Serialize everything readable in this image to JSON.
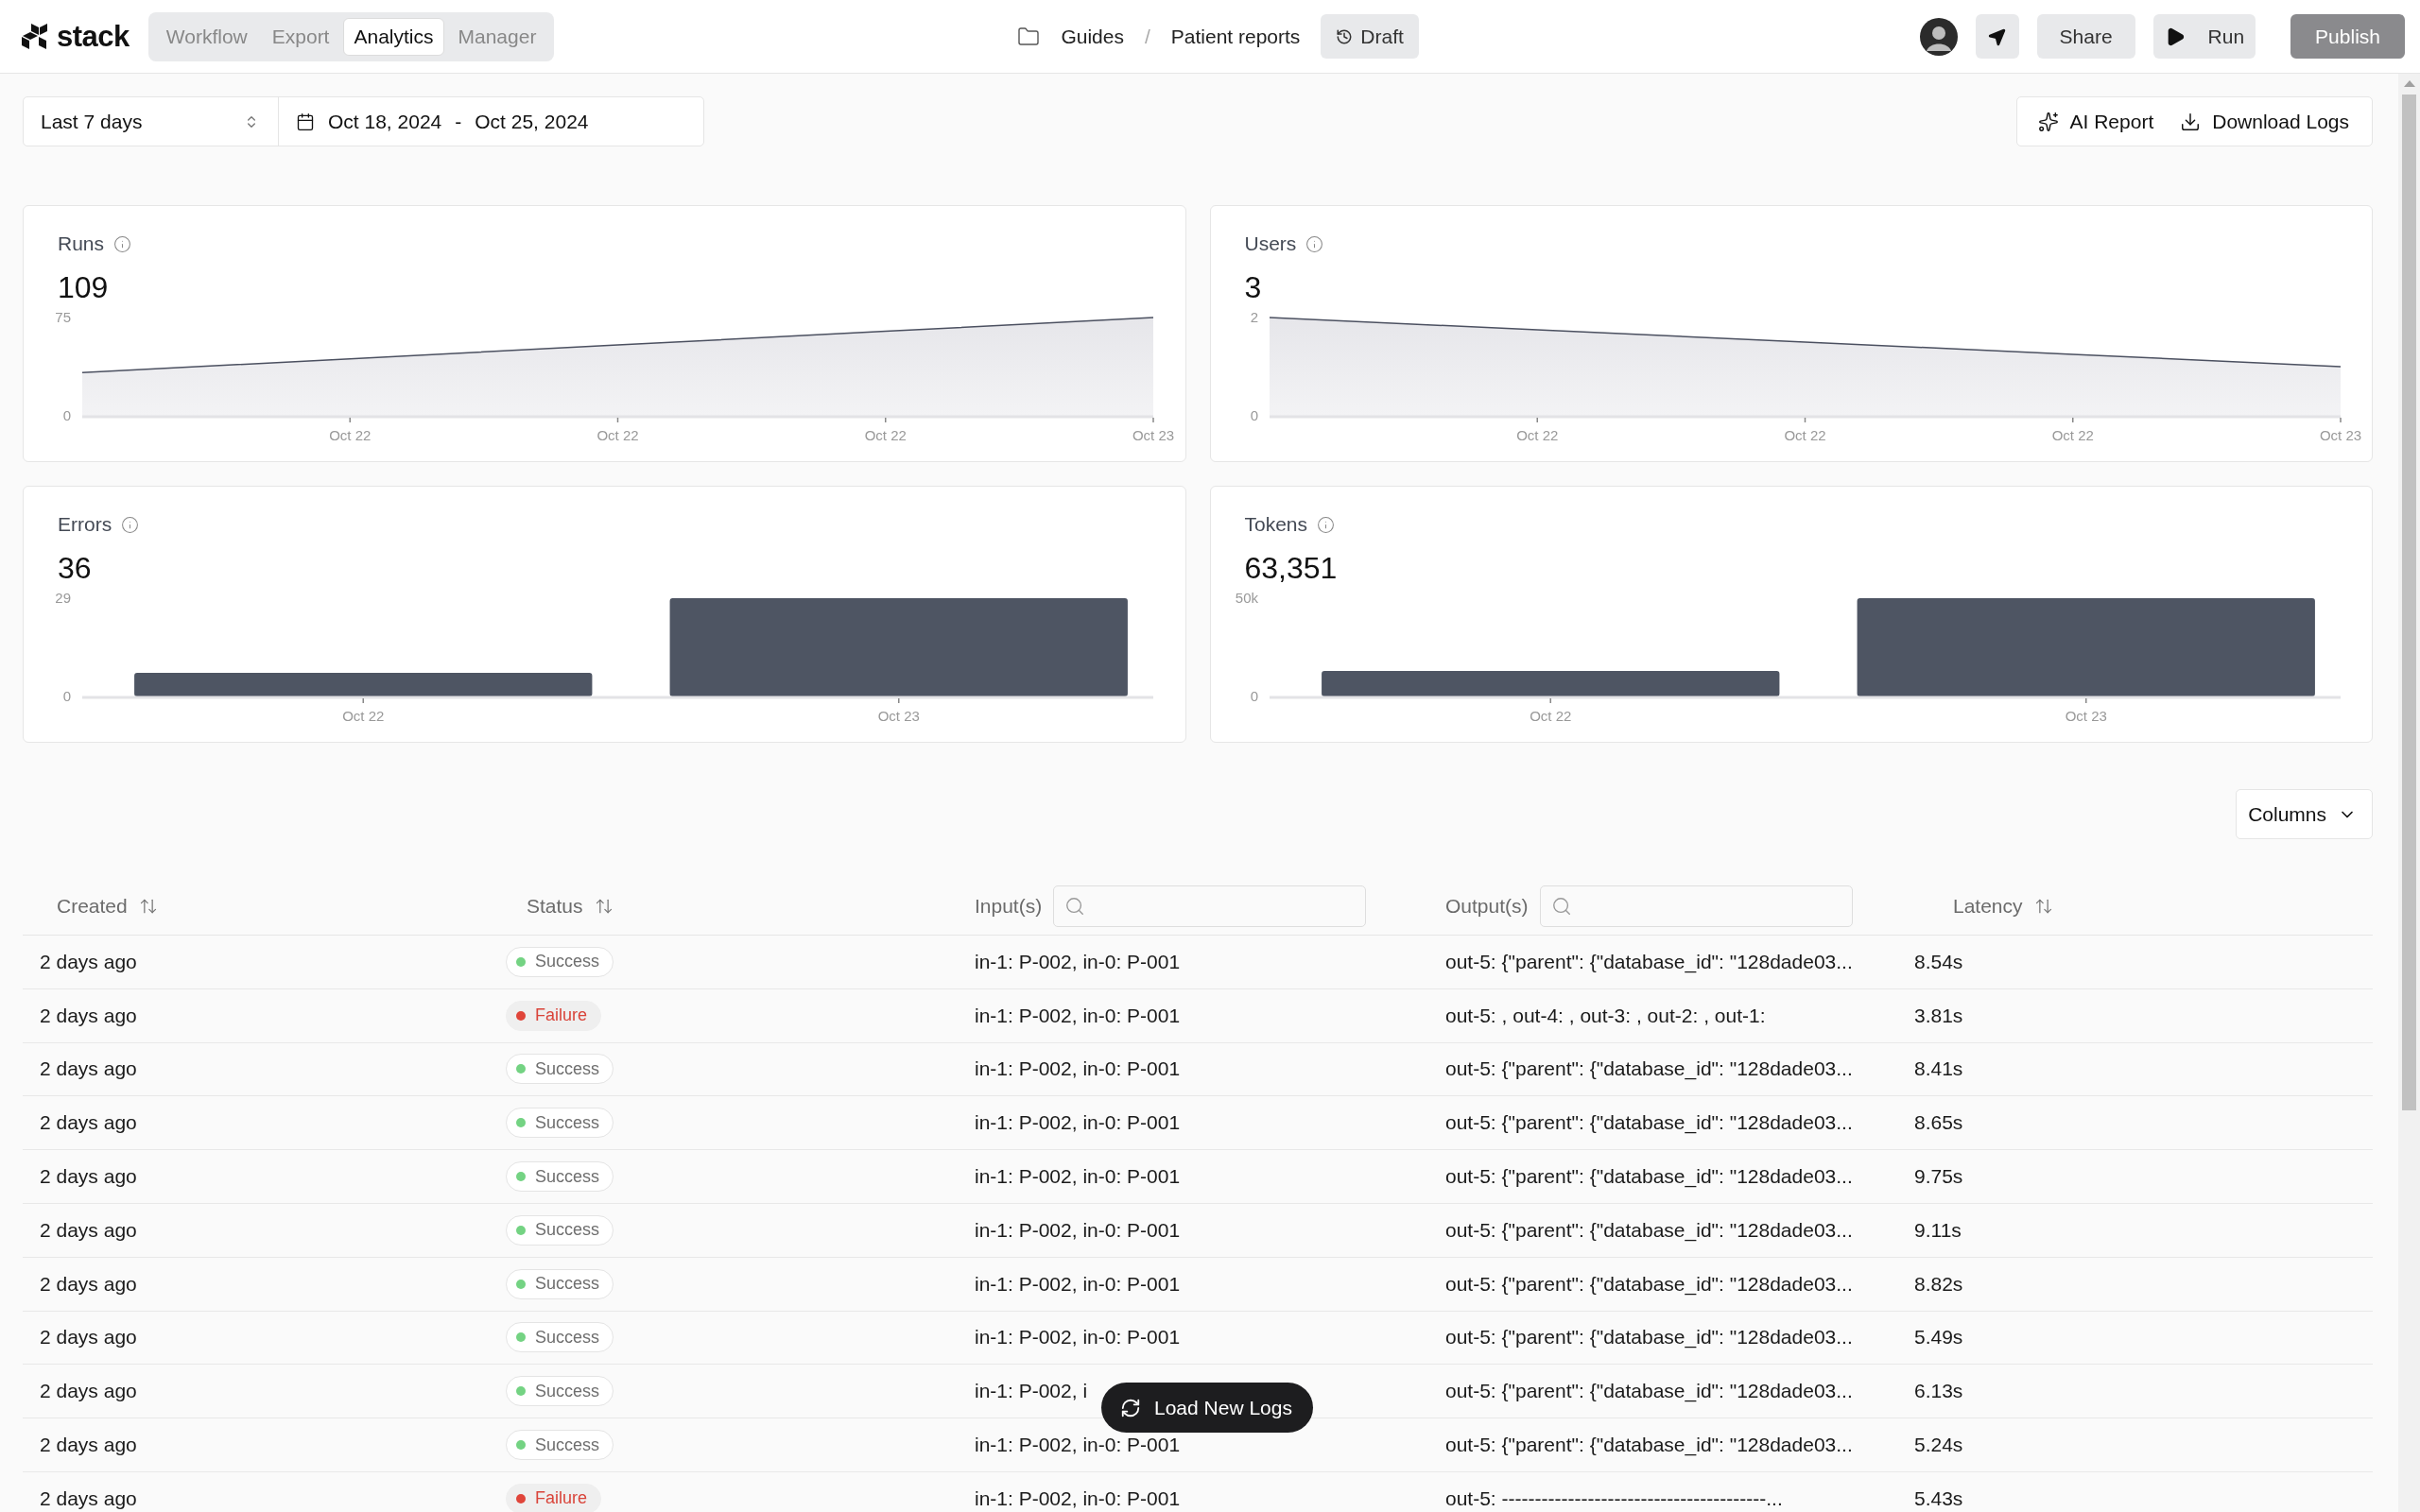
{
  "app": {
    "logo": "stack",
    "tabs": [
      {
        "label": "Workflow",
        "selected": false
      },
      {
        "label": "Export",
        "selected": false
      },
      {
        "label": "Analytics",
        "selected": true
      },
      {
        "label": "Manager",
        "selected": false
      }
    ]
  },
  "breadcrumb": {
    "items": [
      "Guides",
      "Patient reports"
    ],
    "separator": "/",
    "status_button": "Draft"
  },
  "actions": {
    "share": "Share",
    "run": "Run",
    "publish": "Publish"
  },
  "filters": {
    "range_select": "Last 7 days",
    "date_start": "Oct 18, 2024",
    "date_separator": "-",
    "date_end": "Oct 25, 2024",
    "ai_report": "AI Report",
    "download_logs": "Download Logs"
  },
  "metrics": [
    {
      "title": "Runs",
      "value": "109",
      "chart_data": {
        "type": "area",
        "categories": [
          null,
          "Oct 22",
          "Oct 22",
          "Oct 22",
          "Oct 23"
        ],
        "values": [
          33,
          43.5,
          54,
          64.5,
          75
        ],
        "ylim": [
          0,
          75
        ],
        "yticks": [
          0,
          75
        ]
      }
    },
    {
      "title": "Users",
      "value": "3",
      "chart_data": {
        "type": "area",
        "categories": [
          null,
          "Oct 22",
          "Oct 22",
          "Oct 22",
          "Oct 23"
        ],
        "values": [
          2,
          1.75,
          1.5,
          1.25,
          1
        ],
        "ylim": [
          0,
          2
        ],
        "yticks": [
          0,
          2
        ]
      }
    },
    {
      "title": "Errors",
      "value": "36",
      "chart_data": {
        "type": "bar",
        "categories": [
          "Oct 22",
          "Oct 23"
        ],
        "values": [
          7,
          29
        ],
        "ylim": [
          0,
          29
        ],
        "yticks": [
          0,
          29
        ]
      }
    },
    {
      "title": "Tokens",
      "value": "63,351",
      "chart_data": {
        "type": "bar",
        "categories": [
          "Oct 22",
          "Oct 23"
        ],
        "values": [
          13000,
          50000
        ],
        "ylim": [
          0,
          50000
        ],
        "yticks": [
          0,
          {
            "value": 50000,
            "label": "50k"
          }
        ]
      }
    }
  ],
  "table": {
    "columns_button": "Columns",
    "columns": [
      {
        "label": "Created",
        "kind": "sortable"
      },
      {
        "label": "Status",
        "kind": "sortable"
      },
      {
        "label": "Input(s)",
        "kind": "searchable"
      },
      {
        "label": "Output(s)",
        "kind": "searchable"
      },
      {
        "label": "Latency",
        "kind": "sortable"
      }
    ],
    "rows": [
      {
        "created": "2 days ago",
        "status": "Success",
        "kind": "success",
        "input": "in-1: P-002, in-0: P-001",
        "output": "out-5: {\"parent\": {\"database_id\": \"128dade03...",
        "latency": "8.54s"
      },
      {
        "created": "2 days ago",
        "status": "Failure",
        "kind": "failure",
        "input": "in-1: P-002, in-0: P-001",
        "output": "out-5: , out-4: , out-3: , out-2: , out-1:",
        "latency": "3.81s"
      },
      {
        "created": "2 days ago",
        "status": "Success",
        "kind": "success",
        "input": "in-1: P-002, in-0: P-001",
        "output": "out-5: {\"parent\": {\"database_id\": \"128dade03...",
        "latency": "8.41s"
      },
      {
        "created": "2 days ago",
        "status": "Success",
        "kind": "success",
        "input": "in-1: P-002, in-0: P-001",
        "output": "out-5: {\"parent\": {\"database_id\": \"128dade03...",
        "latency": "8.65s"
      },
      {
        "created": "2 days ago",
        "status": "Success",
        "kind": "success",
        "input": "in-1: P-002, in-0: P-001",
        "output": "out-5: {\"parent\": {\"database_id\": \"128dade03...",
        "latency": "9.75s"
      },
      {
        "created": "2 days ago",
        "status": "Success",
        "kind": "success",
        "input": "in-1: P-002, in-0: P-001",
        "output": "out-5: {\"parent\": {\"database_id\": \"128dade03...",
        "latency": "9.11s"
      },
      {
        "created": "2 days ago",
        "status": "Success",
        "kind": "success",
        "input": "in-1: P-002, in-0: P-001",
        "output": "out-5: {\"parent\": {\"database_id\": \"128dade03...",
        "latency": "8.82s"
      },
      {
        "created": "2 days ago",
        "status": "Success",
        "kind": "success",
        "input": "in-1: P-002, in-0: P-001",
        "output": "out-5: {\"parent\": {\"database_id\": \"128dade03...",
        "latency": "5.49s"
      },
      {
        "created": "2 days ago",
        "status": "Success",
        "kind": "success",
        "input": "in-1: P-002, i",
        "output": "out-5: {\"parent\": {\"database_id\": \"128dade03...",
        "latency": "6.13s"
      },
      {
        "created": "2 days ago",
        "status": "Success",
        "kind": "success",
        "input": "in-1: P-002, in-0: P-001",
        "output": "out-5: {\"parent\": {\"database_id\": \"128dade03...",
        "latency": "5.24s"
      },
      {
        "created": "2 days ago",
        "status": "Failure",
        "kind": "failure",
        "input": "in-1: P-002, in-0: P-001",
        "output": "out-5: ----------------------------------------...",
        "latency": "5.43s"
      }
    ]
  },
  "load_button": "Load New Logs"
}
